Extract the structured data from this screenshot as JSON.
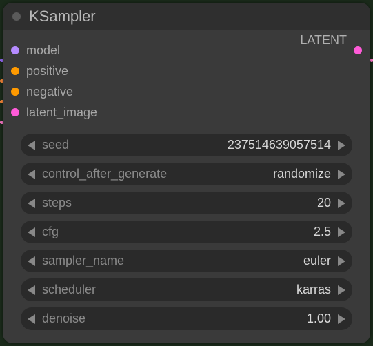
{
  "node": {
    "title": "KSampler",
    "inputs": [
      {
        "label": "model",
        "color": "#b58bff"
      },
      {
        "label": "positive",
        "color": "#ff9a00"
      },
      {
        "label": "negative",
        "color": "#ff9a00"
      },
      {
        "label": "latent_image",
        "color": "#ff5bd8"
      }
    ],
    "outputs": [
      {
        "label": "LATENT",
        "color": "#ff5bd8"
      }
    ],
    "params": [
      {
        "name": "seed",
        "value": "237514639057514"
      },
      {
        "name": "control_after_generate",
        "value": "randomize"
      },
      {
        "name": "steps",
        "value": "20"
      },
      {
        "name": "cfg",
        "value": "2.5"
      },
      {
        "name": "sampler_name",
        "value": "euler"
      },
      {
        "name": "scheduler",
        "value": "karras"
      },
      {
        "name": "denoise",
        "value": "1.00"
      }
    ]
  }
}
